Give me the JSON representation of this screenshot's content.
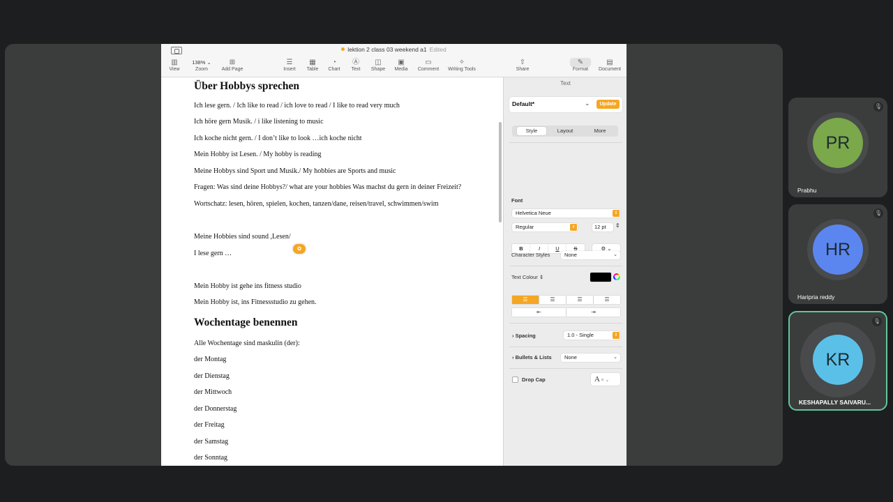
{
  "window": {
    "title": "lektion 2 class 03 weekend a1",
    "status": "Edited"
  },
  "toolbar": {
    "zoom": "138%",
    "items": [
      "View",
      "Zoom",
      "Add Page",
      "Insert",
      "Table",
      "Chart",
      "Text",
      "Shape",
      "Media",
      "Comment",
      "Writing Tools",
      "Share",
      "Format",
      "Document"
    ]
  },
  "doc": {
    "h1": "Über Hobbys sprechen",
    "lines1": [
      "Ich lese gern. / Ich like to read / ich love to read / I like to read very much",
      "Ich höre gern Musik. / i like listening to music",
      "Ich koche nicht gern. / I don’t like to look …ich koche nicht",
      "Mein Hobby ist Lesen. / My hobby is reading",
      "Meine Hobbys sind Sport und Musik./ My hobbies are Sports and music",
      "Fragen: Was sind deine Hobbys?/ what are your hobbies  Was machst du gern in deiner Freizeit?",
      "Wortschatz: lesen, hören, spielen, kochen, tanzen/dane, reisen/travel, schwimmen/swim"
    ],
    "lines2": [
      "Meine Hobbies sind sound ,Lesen/",
      "I lese gern …"
    ],
    "lines3": [
      "Mein Hobby ist gehe ins fitness studio",
      "Mein Hobby ist, ins Fitnessstudio zu gehen."
    ],
    "h2": "Wochentage benennen",
    "lines4": [
      "Alle Wochentage sind maskulin (der):",
      "der Montag",
      "der Dienstag",
      "der Mittwoch",
      "der Donnerstag",
      "der Freitag",
      "der Samstag",
      "der Sonntag"
    ]
  },
  "panel": {
    "title": "Text",
    "style_name": "Default*",
    "update": "Update",
    "tabs": [
      "Style",
      "Layout",
      "More"
    ],
    "font_label": "Font",
    "font": "Helvetica Neue",
    "weight": "Regular",
    "size": "12 pt",
    "bold": "B",
    "italic": "I",
    "underline": "U",
    "strike": "S",
    "char_styles_label": "Character Styles",
    "char_styles": "None",
    "text_colour": "Text Colour",
    "spacing_label": "Spacing",
    "spacing": "1.0 - Single",
    "bullets_label": "Bullets & Lists",
    "bullets": "None",
    "dropcap_label": "Drop Cap"
  },
  "participants": [
    {
      "initials": "PR",
      "name": "Prabhu",
      "color": "#7aa84b"
    },
    {
      "initials": "HR",
      "name": "Haripria reddy",
      "color": "#5b86f0"
    },
    {
      "initials": "KR",
      "name": "KESHAPALLY SAIVARU...",
      "color": "#5bc0e8"
    }
  ]
}
